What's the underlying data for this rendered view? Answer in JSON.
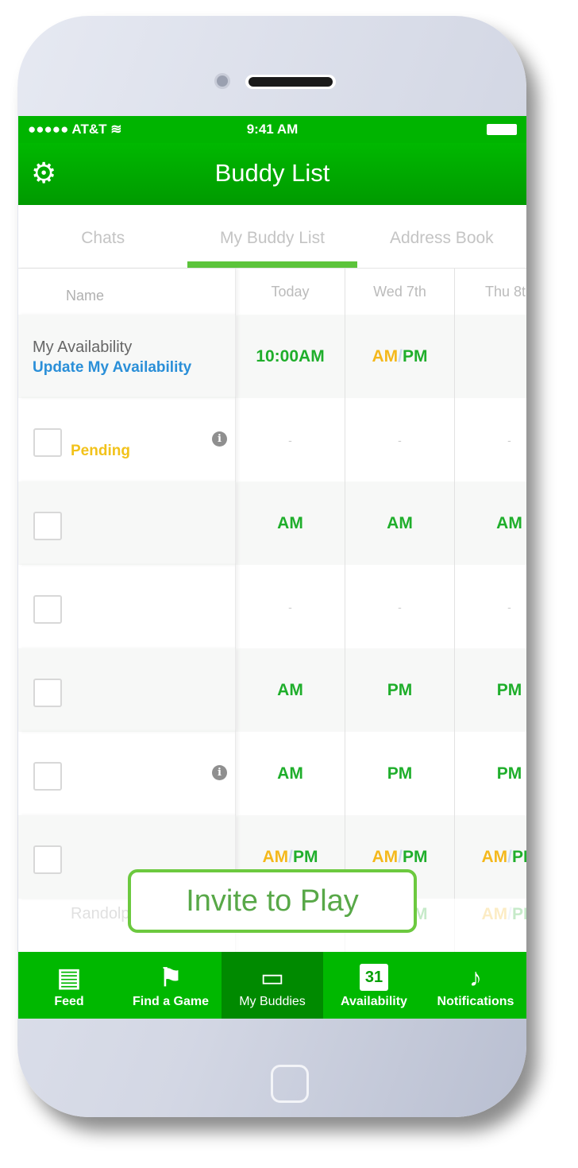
{
  "status_bar": {
    "carrier": "●●●●● AT&T",
    "time": "9:41 AM"
  },
  "nav": {
    "title": "Buddy List",
    "settings_icon": "gear-icon"
  },
  "tabs": [
    {
      "label": "Chats"
    },
    {
      "label": "My Buddy List",
      "active": true
    },
    {
      "label": "Address Book"
    }
  ],
  "table": {
    "headers": {
      "name": "Name",
      "days": [
        "Today",
        "Wed 7th",
        "Thu 8th"
      ]
    },
    "my_availability": {
      "label": "My Availability",
      "link": "Update My Availability",
      "cells": [
        "10:00AM",
        "AM/PM",
        ""
      ]
    },
    "rows": [
      {
        "status": "Pending",
        "info": true,
        "cells": [
          "-",
          "-",
          "-"
        ]
      },
      {
        "cells": [
          "AM",
          "AM",
          "AM"
        ]
      },
      {
        "cells": [
          "-",
          "-",
          "-"
        ]
      },
      {
        "cells": [
          "AM",
          "PM",
          "PM"
        ]
      },
      {
        "info": true,
        "cells": [
          "AM",
          "PM",
          "PM"
        ]
      },
      {
        "cells": [
          "AM/PM",
          "AM/PM",
          "AM/PM"
        ]
      },
      {
        "name": "Randolph Paul",
        "faded": true,
        "cells": [
          "AM/PM",
          "AM/PM",
          "AM/PM"
        ]
      }
    ]
  },
  "invite_button": "Invite to Play",
  "tabbar": [
    {
      "label": "Feed",
      "icon": "newspaper-icon"
    },
    {
      "label": "Find a Game",
      "icon": "golf-flag-icon"
    },
    {
      "label": "My Buddies",
      "icon": "chat-bubble-icon",
      "active": true
    },
    {
      "label": "Availability",
      "icon": "calendar-icon",
      "icon_text": "31"
    },
    {
      "label": "Notifications",
      "icon": "bell-icon"
    }
  ],
  "colors": {
    "brand_green": "#00b400",
    "am": "#f4b81b",
    "pm": "#1fae2b",
    "link": "#2a8fd8"
  }
}
